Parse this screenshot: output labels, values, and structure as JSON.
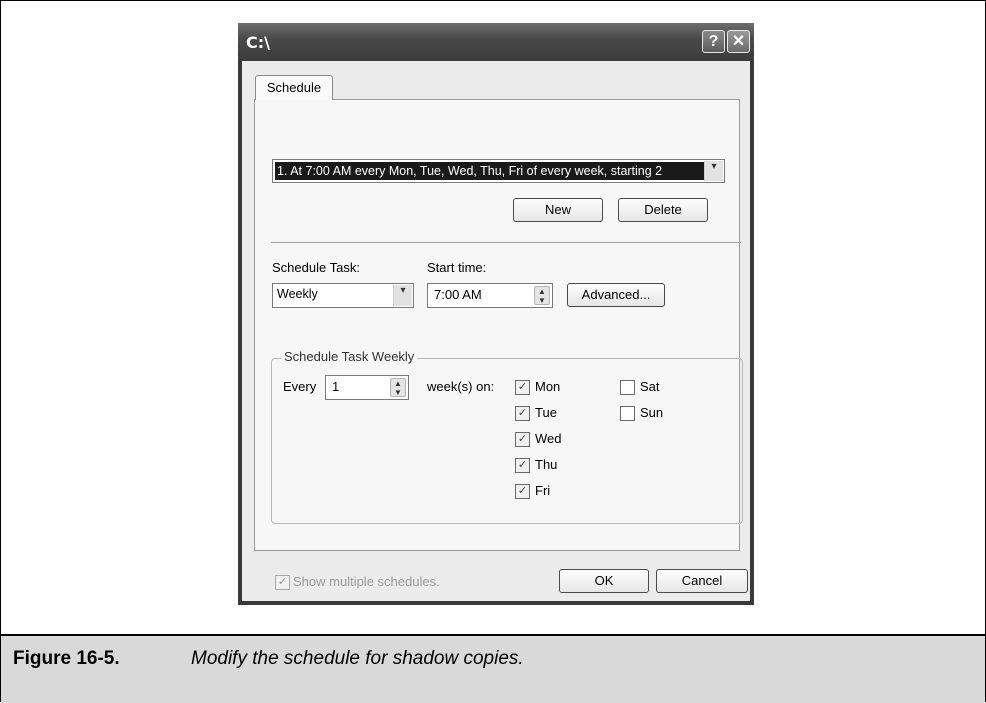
{
  "window": {
    "title": "C:\\",
    "help_glyph": "?",
    "close_glyph": "✕"
  },
  "tab": {
    "label": "Schedule"
  },
  "schedule_list": {
    "selected": "1. At 7:00 AM every Mon, Tue, Wed, Thu, Fri of every week, starting 2",
    "arrow_glyph": "▾"
  },
  "buttons": {
    "new": "New",
    "delete": "Delete",
    "advanced": "Advanced...",
    "ok": "OK",
    "cancel": "Cancel"
  },
  "schedule_task": {
    "label": "Schedule Task:",
    "value": "Weekly"
  },
  "start_time": {
    "label": "Start time:",
    "value": "7:00 AM"
  },
  "weekly_group": {
    "title": "Schedule Task Weekly",
    "every_label": "Every",
    "every_value": "1",
    "weeks_on_label": "week(s) on:",
    "days": [
      {
        "label": "Mon",
        "checked": true
      },
      {
        "label": "Tue",
        "checked": true
      },
      {
        "label": "Wed",
        "checked": true
      },
      {
        "label": "Thu",
        "checked": true
      },
      {
        "label": "Fri",
        "checked": true
      },
      {
        "label": "Sat",
        "checked": false
      },
      {
        "label": "Sun",
        "checked": false
      }
    ]
  },
  "show_multiple": {
    "label": "Show multiple schedules.",
    "checked": true,
    "disabled": true
  },
  "caption": {
    "label": "Figure 16-5.",
    "text": "Modify the schedule for shadow copies."
  }
}
